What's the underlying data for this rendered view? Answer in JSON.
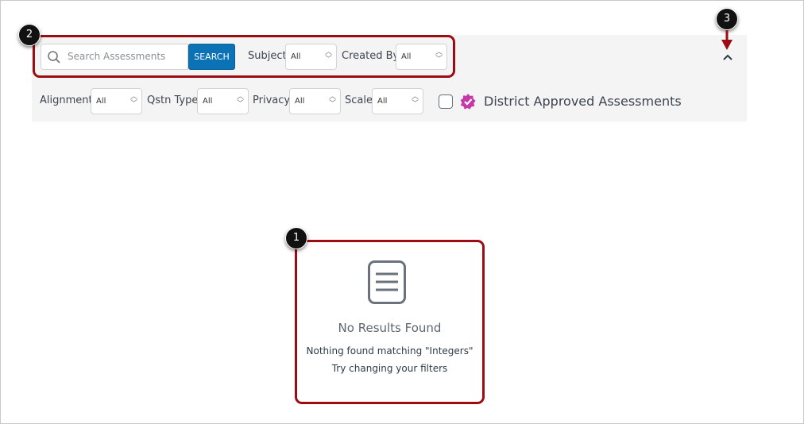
{
  "filters": {
    "search_placeholder": "Search Assessments",
    "search_button": "SEARCH",
    "subject": {
      "label": "Subject",
      "value": "All"
    },
    "created_by": {
      "label": "Created By",
      "value": "All"
    },
    "alignment": {
      "label": "Alignment",
      "value": "All"
    },
    "qstn_type": {
      "label": "Qstn Type",
      "value": "All"
    },
    "privacy": {
      "label": "Privacy",
      "value": "All"
    },
    "scale": {
      "label": "Scale",
      "value": "All"
    },
    "district_approved_label": "District Approved Assessments"
  },
  "empty_state": {
    "title": "No Results Found",
    "message": "Nothing found matching \"Integers\"",
    "hint": "Try changing your filters"
  },
  "callouts": {
    "one": "1",
    "two": "2",
    "three": "3"
  },
  "colors": {
    "accent": "#0b72b5",
    "callout_border": "#9b0d12",
    "badge": "#c43aa6"
  }
}
